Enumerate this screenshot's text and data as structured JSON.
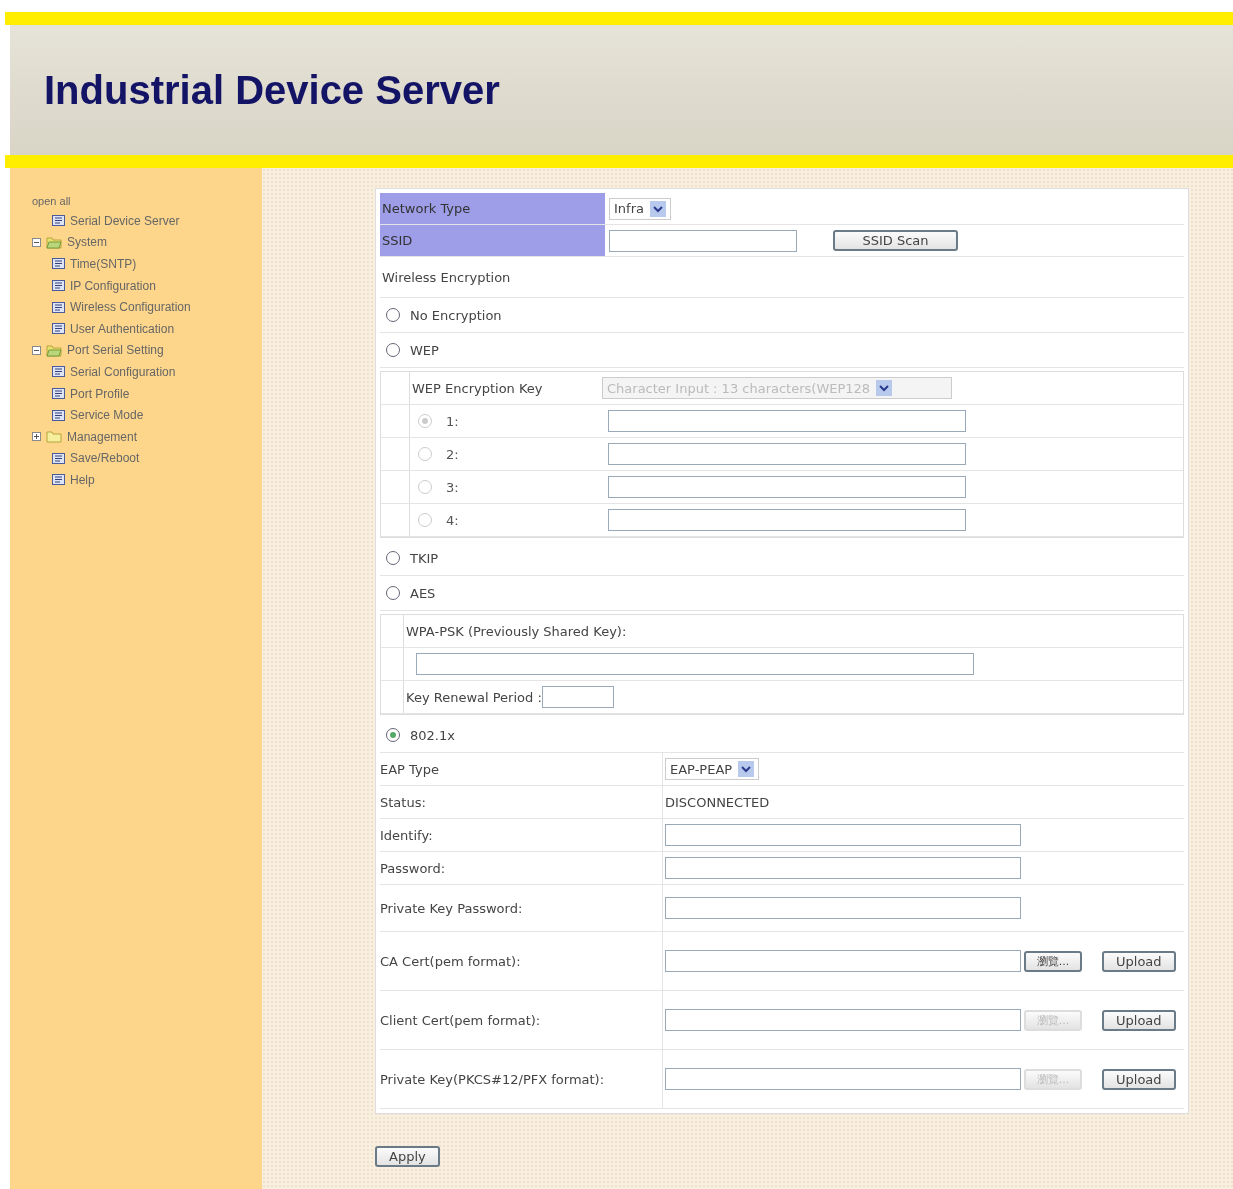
{
  "header": {
    "title": "Industrial Device Server"
  },
  "sidebar": {
    "open_all": "open all",
    "items": [
      {
        "label": "Serial Device Server",
        "kind": "page"
      },
      {
        "label": "System",
        "kind": "folder",
        "expanded": true,
        "children": [
          {
            "label": "Time(SNTP)",
            "kind": "page"
          },
          {
            "label": "IP Configuration",
            "kind": "page"
          },
          {
            "label": "Wireless Configuration",
            "kind": "page"
          },
          {
            "label": "User Authentication",
            "kind": "page"
          }
        ]
      },
      {
        "label": "Port Serial Setting",
        "kind": "folder",
        "expanded": true,
        "children": [
          {
            "label": "Serial Configuration",
            "kind": "page"
          },
          {
            "label": "Port Profile",
            "kind": "page"
          },
          {
            "label": "Service Mode",
            "kind": "page"
          }
        ]
      },
      {
        "label": "Management",
        "kind": "folder",
        "expanded": false
      },
      {
        "label": "Save/Reboot",
        "kind": "page"
      },
      {
        "label": "Help",
        "kind": "page"
      }
    ]
  },
  "form": {
    "network_type": {
      "label": "Network Type",
      "value": "Infra"
    },
    "ssid": {
      "label": "SSID",
      "button": "SSID Scan"
    },
    "encryption_heading": "Wireless Encryption",
    "encryption": [
      {
        "label": "No Encryption",
        "selected": false
      },
      {
        "label": "WEP",
        "selected": false,
        "wep": {
          "key_label": "WEP Encryption Key",
          "key_mode": "Character Input : 13 characters(WEP128",
          "disabled": true,
          "keys": [
            {
              "label": "1:",
              "selected": true
            },
            {
              "label": "2:",
              "selected": false
            },
            {
              "label": "3:",
              "selected": false
            },
            {
              "label": "4:",
              "selected": false
            }
          ]
        }
      },
      {
        "label": "TKIP",
        "selected": false
      },
      {
        "label": "AES",
        "selected": false,
        "wpa": {
          "psk_label": "WPA-PSK (Previously Shared Key):",
          "renewal_label": "Key Renewal Period :"
        }
      },
      {
        "label": "802.1x",
        "selected": true,
        "eap": {
          "type_label": "EAP Type",
          "type_value": "EAP-PEAP",
          "status_label": "Status:",
          "status_value": "DISCONNECTED",
          "fields": [
            {
              "label": "Identify:"
            },
            {
              "label": "Password:"
            },
            {
              "label": "Private Key Password:"
            }
          ],
          "certs": [
            {
              "label": "CA Cert(pem format):",
              "browse": "瀏覽...",
              "disabled": false,
              "upload": "Upload"
            },
            {
              "label": "Client Cert(pem format):",
              "browse": "瀏覽...",
              "disabled": true,
              "upload": "Upload"
            },
            {
              "label": "Private Key(PKCS#12/PFX format):",
              "browse": "瀏覽...",
              "disabled": true,
              "upload": "Upload"
            }
          ]
        }
      }
    ]
  },
  "apply": "Apply"
}
